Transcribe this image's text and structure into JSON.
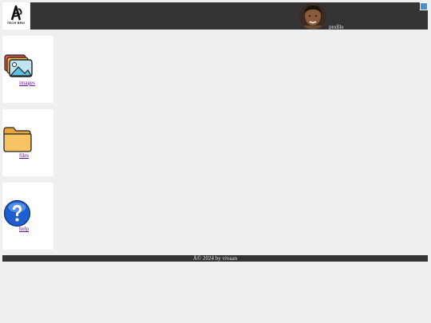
{
  "header": {
    "logo_text": "TECH BRO",
    "profile_label": "profile",
    "logo_icon": "techbro-logo-icon",
    "avatar_icon": "profile-avatar",
    "corner_icon": "expand-icon"
  },
  "cards": [
    {
      "label": "images",
      "icon": "images-icon"
    },
    {
      "label": "files",
      "icon": "folder-icon"
    },
    {
      "label": "help",
      "icon": "help-icon"
    }
  ],
  "footer": {
    "text": "Â© 2024 by vivaan"
  },
  "colors": {
    "bar": "#333333",
    "background": "#efefef",
    "link": "#6a0dad"
  }
}
